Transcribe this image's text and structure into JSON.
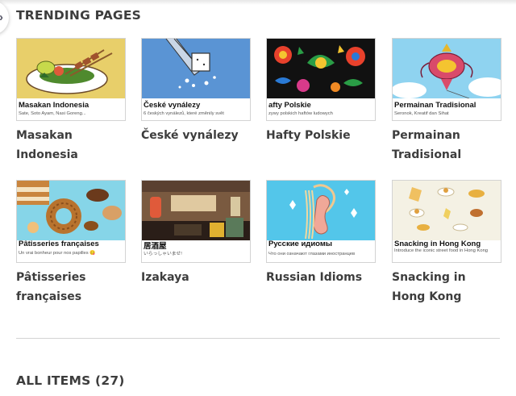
{
  "sections": {
    "trending_title": "TRENDING PAGES",
    "all_items_title": "ALL ITEMS (27)"
  },
  "nav": {
    "arrow_icon": "chevron-right-icon"
  },
  "cards": [
    {
      "label": "Masakan Indonesia",
      "thumb_title": "Masakan Indonesia",
      "thumb_sub": "Sate, Soto Ayam, Nasi Goreng..."
    },
    {
      "label": "České vynálezy",
      "thumb_title": "České vynálezy",
      "thumb_sub": "6 českých vynálezů, které změnily svět"
    },
    {
      "label": "Hafty Polskie",
      "thumb_title": "afty Polskie",
      "thumb_sub": "zywy polskich haftów ludowych"
    },
    {
      "label": "Permainan Tradisional",
      "thumb_title": "Permainan Tradisional",
      "thumb_sub": "Seronok, Kreatif dan Sihat"
    },
    {
      "label": "Pâtisseries françaises",
      "thumb_title": "Pâtisseries françaises",
      "thumb_sub": "Un vrai bonheur pour nos papilles 😋"
    },
    {
      "label": "Izakaya",
      "thumb_title": "居酒屋",
      "thumb_sub": "いらっしゃいませ!"
    },
    {
      "label": "Russian Idioms",
      "thumb_title": "Русские идиомы",
      "thumb_sub": "Что они означают глазами иностранцев"
    },
    {
      "label": "Snacking in Hong Kong",
      "thumb_title": "Snacking in Hong Kong",
      "thumb_sub": "Introduce the iconic street food in Hong Kong"
    }
  ],
  "colors": {
    "thumb_indonesia": "#e8cf6a",
    "thumb_czech": "#5a94d4",
    "thumb_polish": "#111111",
    "thumb_permainan": "#8fd3f0",
    "thumb_patisserie": "#86d5e8",
    "thumb_izakaya": "#3a2a22",
    "thumb_russian": "#53c6ea",
    "thumb_hongkong": "#f4f1e4"
  }
}
